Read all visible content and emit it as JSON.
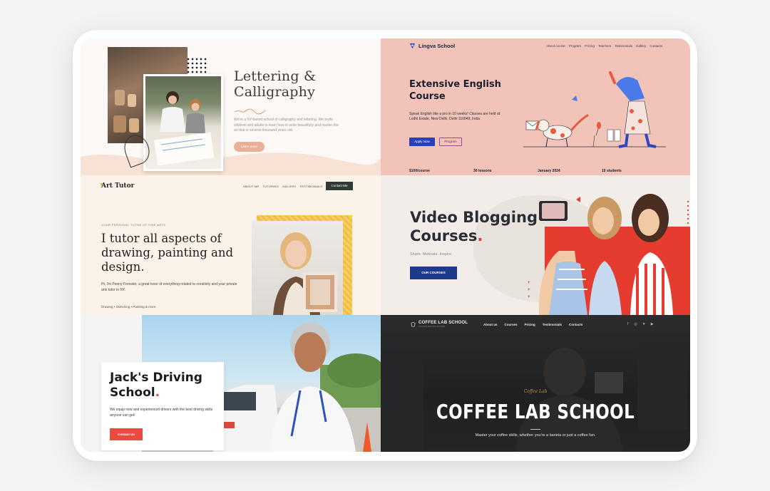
{
  "lettering": {
    "title_line1": "Lettering &",
    "title_line2": "Calligraphy",
    "description": "We're a NY-based school of calligraphy and lettering. We invite children and adults to learn how to write beautifully and master the art that is several thousand years old.",
    "button": "Learn more"
  },
  "lingva": {
    "logo": "Lingva School",
    "nav": [
      "About course",
      "Program",
      "Pricing",
      "Teachers",
      "Testimonials",
      "Gallery",
      "Contacts"
    ],
    "title": "Extensive English Course",
    "description": "Speak English like a pro in 10 weeks! Classes are held at: Lodhi Estate, New Delhi, Delhi 110049, India",
    "primary_button": "Apply Now",
    "secondary_button": "Program",
    "stats": [
      "$100/course",
      "30 lessons",
      "January 2024",
      "10 students"
    ],
    "colors": {
      "background": "#f2c3b9",
      "accent": "#2b3fb8"
    }
  },
  "art_tutor": {
    "logo": "Art Tutor",
    "nav": [
      "ABOUT ME",
      "TUTORING",
      "GALLERY",
      "TESTIMONIALS"
    ],
    "cta": "Contact Me",
    "eyebrow": "YOUR PERSONAL TUTOR OF FINE ARTS",
    "title": "I tutor all aspects of drawing, painting and design.",
    "description": "Hi, I'm Penny Forester, a great lover of everything related to creativity and your private arts tutor in NY.",
    "tags": "Drawing • Sketching • Painting & more"
  },
  "video_blogging": {
    "title_line1": "Video Blogging",
    "title_line2": "Courses",
    "title_dot": ".",
    "subtitle": "Share. Motivate. Inspire.",
    "button": "OUR COURSES",
    "colors": {
      "accent": "#e63c2f",
      "button": "#1f3a8a"
    }
  },
  "driving": {
    "title_line1": "Jack's Driving",
    "title_line2": "School",
    "title_dot": ".",
    "description": "We equip new and experienced drivers with the best driving skills anyone can get!",
    "button": "Contact Us",
    "colors": {
      "accent": "#e94b3c"
    }
  },
  "coffee": {
    "logo": "COFFEE LAB SCHOOL",
    "logo_sub": "COFFEE MAKING SCHOOL",
    "nav": [
      "About us",
      "Courses",
      "Pricing",
      "Testimonials",
      "Contacts"
    ],
    "social_icons": [
      "facebook-icon",
      "instagram-icon",
      "twitter-icon",
      "youtube-icon"
    ],
    "script": "Coffee Lab",
    "title": "COFFEE LAB SCHOOL",
    "description": "Master your coffee skills, whether you're a barista or just a coffee fan.",
    "colors": {
      "accent": "#c8923f"
    }
  }
}
